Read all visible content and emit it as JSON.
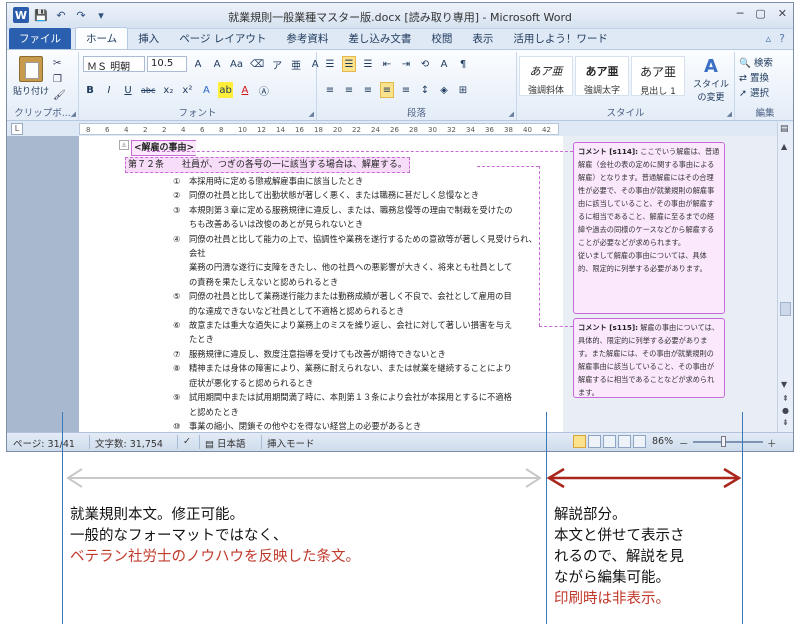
{
  "window": {
    "title": "就業規則一般業種マスター版.docx [読み取り専用] - Microsoft Word",
    "logo_letter": "W",
    "qat": [
      "↶",
      "↷",
      "▾"
    ],
    "controls": [
      "─",
      "▢",
      "✕"
    ]
  },
  "tabs": [
    "ファイル",
    "ホーム",
    "挿入",
    "ページ レイアウト",
    "参考資料",
    "差し込み文書",
    "校閲",
    "表示",
    "活用しよう！ワード"
  ],
  "tab_right": [
    "▵",
    "?"
  ],
  "ribbon": {
    "clipboard": {
      "paste_label": "貼り付け",
      "group_label": "クリップボ..."
    },
    "font": {
      "font_name": "ＭＳ 明朝",
      "font_size": "10.5",
      "row1": [
        "A",
        "A",
        "Aa",
        "ア",
        "亜",
        "A"
      ],
      "row2": [
        "B",
        "I",
        "U",
        "abc",
        "x₂",
        "x²",
        "A",
        "ab",
        "A",
        "Ⓐ"
      ],
      "group_label": "フォント"
    },
    "paragraph": {
      "row1": [
        "☰",
        "☰",
        "☰",
        "⇤",
        "⇥",
        "⟲",
        "A",
        "¶"
      ],
      "row2": [
        "≡",
        "≡",
        "≡",
        "≡",
        "≡",
        "↕",
        "◈",
        "⊞"
      ],
      "group_label": "段落"
    },
    "styles": {
      "items": [
        {
          "sample": "あア亜",
          "name": "強調斜体"
        },
        {
          "sample": "あア亜",
          "name": "強調太字"
        },
        {
          "sample": "あア亜",
          "name": "見出し 1"
        }
      ],
      "change_label": "スタイルの変更",
      "group_label": "スタイル"
    },
    "editing": {
      "items": [
        "検索",
        "置換",
        "選択"
      ],
      "group_label": "編集"
    }
  },
  "ruler": [
    "8",
    "6",
    "4",
    "2",
    "2",
    "4",
    "6",
    "8",
    "10",
    "12",
    "14",
    "16",
    "18",
    "20",
    "22",
    "24",
    "26",
    "28",
    "30",
    "32",
    "34",
    "36",
    "38",
    "40",
    "42"
  ],
  "document": {
    "heading": "<解雇の事由>",
    "article": "第７２条　　社員が、つぎの各号の一に該当する場合は、解雇する。",
    "items": [
      {
        "num": "①",
        "lines": [
          "本採用時に定める懲戒解雇事由に該当したとき"
        ]
      },
      {
        "num": "②",
        "lines": [
          "同僚の社員と比して出勤状態が著しく悪く、または職務に甚だしく怠慢なとき"
        ]
      },
      {
        "num": "③",
        "lines": [
          "本規則第３章に定める服務規律に違反し、または、職務怠慢等の理由で制裁を受けたの",
          "ちも改善あるいは改悛のあとが見られないとき"
        ]
      },
      {
        "num": "④",
        "lines": [
          "同僚の社員と比して能力の上で、協調性や業務を遂行するための意欲等が著しく見受けられ、会社",
          "業務の円滑な遂行に支障をきたし、他の社員への悪影響が大きく、将来とも社員として",
          "の責務を果たしえないと認められるとき"
        ]
      },
      {
        "num": "⑤",
        "lines": [
          "同僚の社員と比して業務遂行能力または勤務成績が著しく不良で、会社として雇用の目",
          "的な達成できないなど社員として不適格と認められるとき"
        ]
      },
      {
        "num": "⑥",
        "lines": [
          "故意または重大な過失により業務上のミスを繰り返し、会社に対して著しい損害を与え",
          "たとき"
        ]
      },
      {
        "num": "⑦",
        "lines": [
          "服務規律に違反し、数度注意指導を受けても改善が期待できないとき"
        ]
      },
      {
        "num": "⑧",
        "lines": [
          "精神または身体の障害により、業務に耐えられない、または就業を継続することにより",
          "症状が悪化すると認められるとき"
        ]
      },
      {
        "num": "⑨",
        "lines": [
          "試用期間中または試用期間満了時に、本則第１３条により会社が本採用とするに不適格",
          "と認めたとき"
        ]
      },
      {
        "num": "⑩",
        "lines": [
          "事業の縮小、閉鎖その他やむを得ない経営上の必要があるとき"
        ]
      }
    ]
  },
  "comments": [
    {
      "tag": "コメント [s114]:",
      "text": "ここでいう解雇は、普通解雇（会社の表の定めに関する事由による解雇）となります。普通解雇にはその合理性が必要で、その事由が就業規則の解雇事由に該当していること、その事由が解雇するに相当であること、解雇に至るまでの経緯や過去の同様のケースなどから解雇することが必要などが求められます。",
      "text2": "従いまして解雇の事由については、具体的、限定的に列挙する必要があります。"
    },
    {
      "tag": "コメント [s115]:",
      "text": "解雇の事由については、具体的、限定的に列挙する必要があります。また解雇には、その事由が就業規則の解雇事由に該当していること、その事由が解雇するに相当であることなどが求められます。"
    }
  ],
  "statusbar": {
    "page": "ページ: 31/41",
    "words": "文字数: 31,754",
    "lang": "日本語",
    "mode": "挿入モード",
    "zoom": "86%",
    "zoom_minus": "－",
    "zoom_plus": "＋"
  },
  "annotations": {
    "left": {
      "line1": "就業規則本文。修正可能。",
      "line2": "一般的なフォーマットではなく、",
      "line3": "ベテラン社労士のノウハウを反映した条文。"
    },
    "right": {
      "line1": "解説部分。",
      "line2": "本文と併せて表示さ",
      "line3": "れるので、解説を見",
      "line4": "ながら編集可能。",
      "line5": "印刷時は非表示。"
    }
  },
  "colors": {
    "accent": "#c0392b",
    "grey_arrow": "#c8c8c8",
    "red_arrow": "#a8261c",
    "comment_border": "#c86bd8"
  }
}
